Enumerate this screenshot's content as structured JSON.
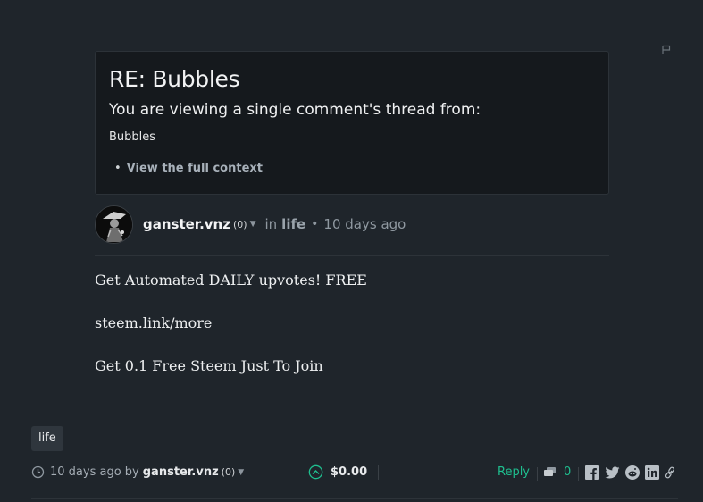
{
  "context": {
    "title": "RE: Bubbles",
    "subtitle": "You are viewing a single comment's thread from:",
    "parent_link": "Bubbles",
    "view_full_context": "View the full context"
  },
  "author": {
    "name": "ganster.vnz",
    "reputation": "(0)",
    "in_label": "in",
    "category": "life",
    "time": "10 days ago"
  },
  "body": {
    "paragraphs": [
      "Get Automated DAILY upvotes! FREE",
      "steem.link/more",
      "Get 0.1 Free Steem Just To Join"
    ]
  },
  "tags": [
    "life"
  ],
  "footer": {
    "time_prefix": "10 days ago by",
    "author": "ganster.vnz",
    "reputation": "(0)",
    "payout": "$0.00",
    "reply_label": "Reply",
    "comment_count": "0"
  },
  "icons": {
    "flag": "flag-icon",
    "clock": "clock-icon",
    "upvote": "upvote-icon",
    "comments": "comments-icon",
    "facebook": "facebook-icon",
    "twitter": "twitter-icon",
    "reddit": "reddit-icon",
    "linkedin": "linkedin-icon",
    "link": "link-icon"
  },
  "colors": {
    "background": "#1f252b",
    "accent": "#1fbf8f"
  }
}
